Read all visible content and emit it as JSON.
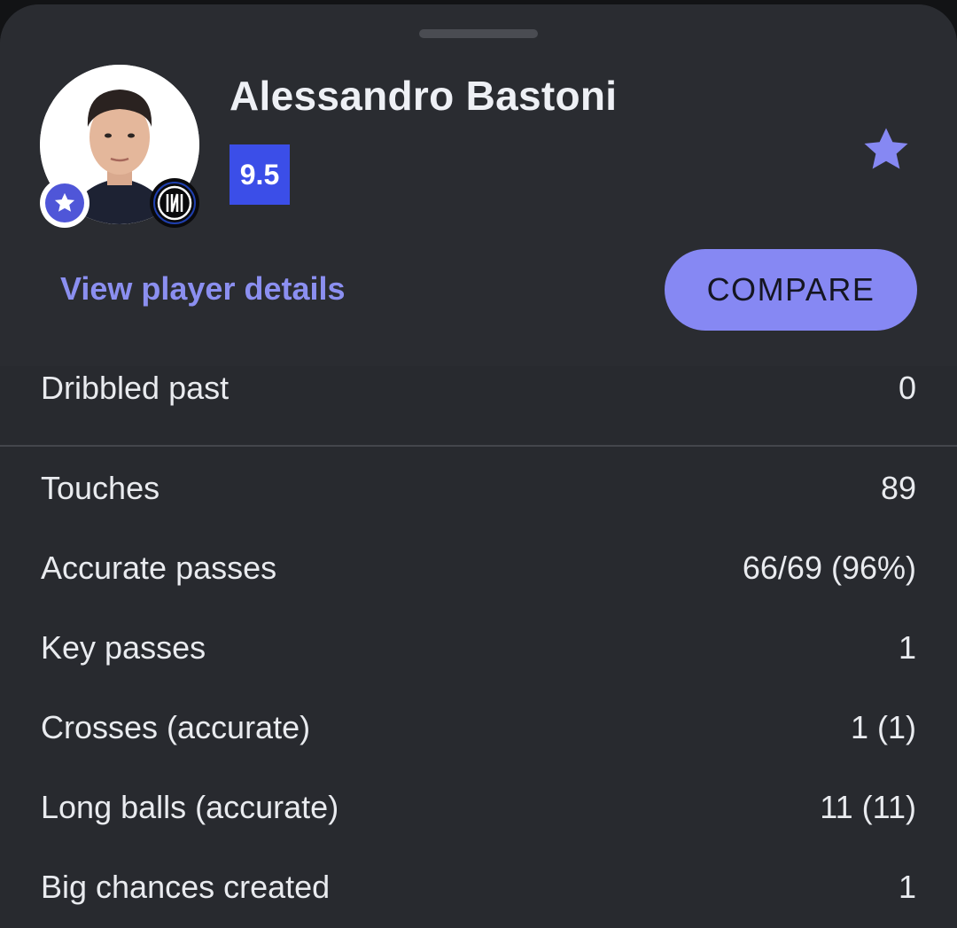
{
  "player": {
    "name": "Alessandro Bastoni",
    "rating": "9.5",
    "rating_color": "#3b4ee8"
  },
  "actions": {
    "details_link": "View player details",
    "compare_button": "COMPARE"
  },
  "colors": {
    "accent": "#8688f3",
    "sheet_bg": "#282a2f",
    "text": "#e9ebef"
  },
  "icons": {
    "favorite": "star-icon",
    "badge": "star-badge-icon",
    "club": "club-crest-icon"
  },
  "stats_top": [
    {
      "label": "Dribbled past",
      "value": "0"
    }
  ],
  "stats": [
    {
      "label": "Touches",
      "value": "89"
    },
    {
      "label": "Accurate passes",
      "value": "66/69 (96%)"
    },
    {
      "label": "Key passes",
      "value": "1"
    },
    {
      "label": "Crosses (accurate)",
      "value": "1 (1)"
    },
    {
      "label": "Long balls (accurate)",
      "value": "11 (11)"
    },
    {
      "label": "Big chances created",
      "value": "1"
    }
  ]
}
